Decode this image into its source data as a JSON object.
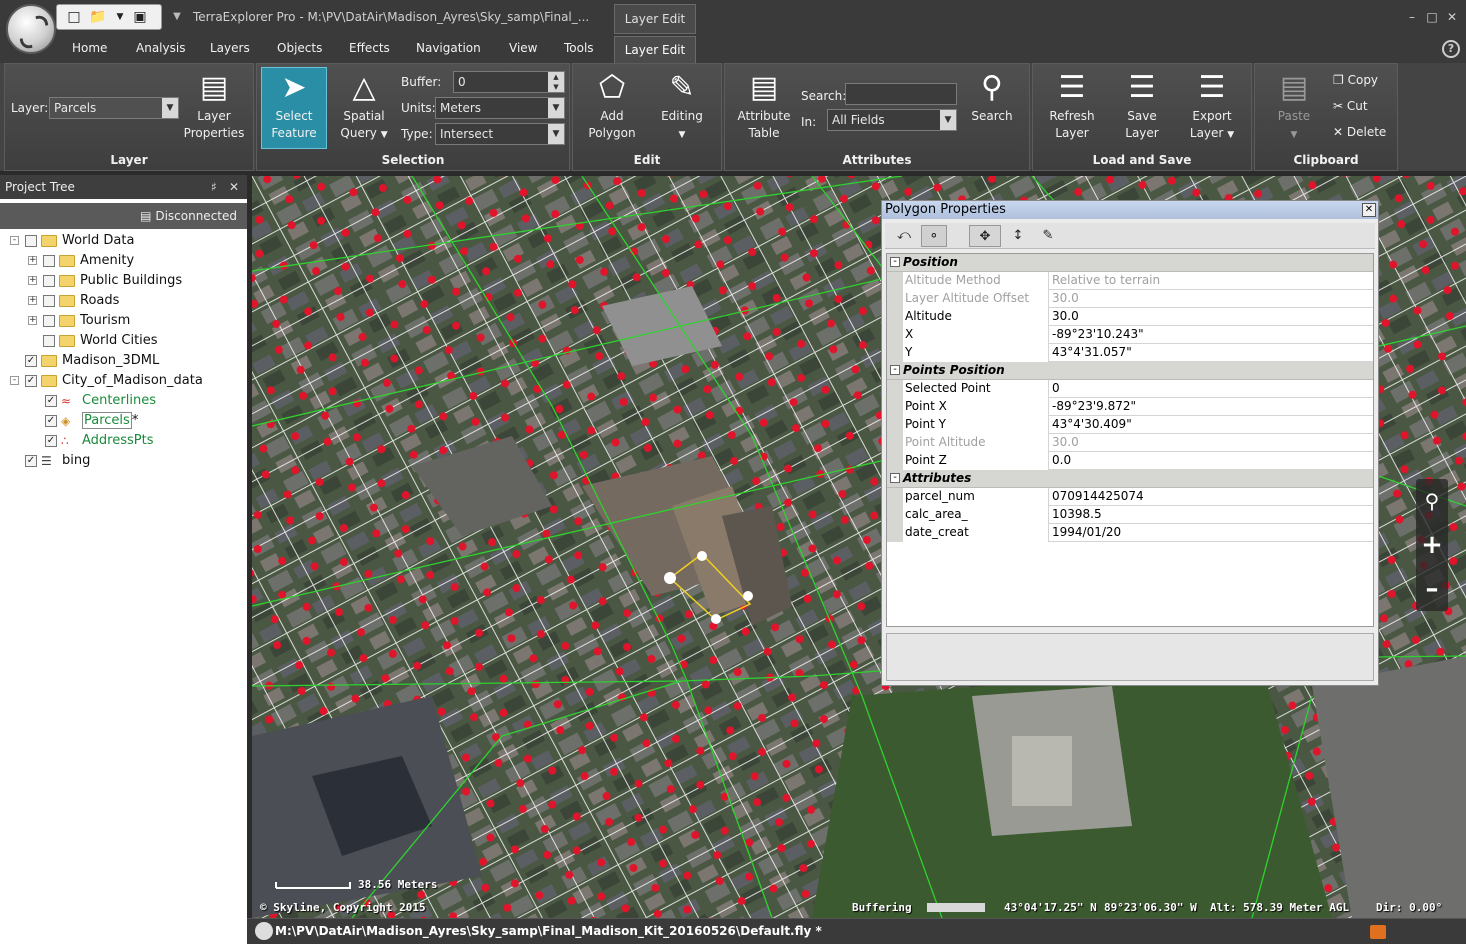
{
  "window": {
    "title": "TerraExplorer Pro - M:\\PV\\DatAir\\Madison_Ayres\\Sky_samp\\Final_...",
    "context_tab": "Layer Edit"
  },
  "tabs": [
    "Home",
    "Analysis",
    "Layers",
    "Objects",
    "Effects",
    "Navigation",
    "View",
    "Tools",
    "Layer Edit"
  ],
  "ribbon": {
    "layer": {
      "label": "Layer:",
      "value": "Parcels",
      "props_line1": "Layer",
      "props_line2": "Properties",
      "group": "Layer"
    },
    "selection": {
      "select_line1": "Select",
      "select_line2": "Feature",
      "spatial_line1": "Spatial",
      "spatial_line2": "Query",
      "buffer_label": "Buffer:",
      "buffer_value": "0",
      "units_label": "Units:",
      "units_value": "Meters",
      "type_label": "Type:",
      "type_value": "Intersect",
      "group": "Selection"
    },
    "edit": {
      "add_line1": "Add",
      "add_line2": "Polygon",
      "editing": "Editing",
      "group": "Edit"
    },
    "attributes": {
      "table_line1": "Attribute",
      "table_line2": "Table",
      "search_label": "Search:",
      "search_value": "",
      "in_label": "In:",
      "in_value": "All Fields",
      "search_btn": "Search",
      "group": "Attributes"
    },
    "loadsave": {
      "refresh_line1": "Refresh",
      "refresh_line2": "Layer",
      "save_line1": "Save",
      "save_line2": "Layer",
      "export_line1": "Export",
      "export_line2": "Layer",
      "group": "Load and Save"
    },
    "clipboard": {
      "paste": "Paste",
      "copy": "Copy",
      "cut": "Cut",
      "delete": "Delete",
      "group": "Clipboard"
    }
  },
  "project_tree": {
    "title": "Project Tree",
    "status": "Disconnected",
    "items": [
      {
        "label": "World Data"
      },
      {
        "label": "Amenity"
      },
      {
        "label": "Public Buildings"
      },
      {
        "label": "Roads"
      },
      {
        "label": "Tourism"
      },
      {
        "label": "World Cities"
      },
      {
        "label": "Madison_3DML"
      },
      {
        "label": "City_of_Madison_data"
      },
      {
        "label": "Centerlines"
      },
      {
        "label": "Parcels",
        "suffix": "*"
      },
      {
        "label": "AddressPts"
      },
      {
        "label": "bing"
      }
    ]
  },
  "polygon_properties": {
    "title": "Polygon Properties",
    "sections": {
      "position": "Position",
      "points_position": "Points Position",
      "attributes": "Attributes"
    },
    "rows": [
      {
        "key": "Altitude Method",
        "value": "Relative to terrain"
      },
      {
        "key": "Layer Altitude Offset",
        "value": "30.0"
      },
      {
        "key": "Altitude",
        "value": "30.0"
      },
      {
        "key": "X",
        "value": "-89°23'10.243\""
      },
      {
        "key": "Y",
        "value": "43°4'31.057\""
      },
      {
        "key": "Selected Point",
        "value": "0"
      },
      {
        "key": "Point X",
        "value": "-89°23'9.872\""
      },
      {
        "key": "Point Y",
        "value": "43°4'30.409\""
      },
      {
        "key": "Point Altitude",
        "value": "30.0"
      },
      {
        "key": "Point Z",
        "value": "0.0"
      },
      {
        "key": "parcel_num",
        "value": "070914425074"
      },
      {
        "key": "calc_area_",
        "value": "10398.5"
      },
      {
        "key": "date_creat",
        "value": "1994/01/20"
      }
    ]
  },
  "map": {
    "scale": "38.56 Meters",
    "copyright": "© Skyline, Copyright 2015",
    "buffering": "Buffering",
    "lat": "43°04'17.25\" N",
    "lon": "89°23'06.30\" W",
    "alt": "Alt: 578.39 Meter AGL",
    "dir": "Dir: 0.00°"
  },
  "statusbar": {
    "path": "M:\\PV\\DatAir\\Madison_Ayres\\Sky_samp\\Final_Madison_Kit_20160526\\Default.fly *"
  }
}
